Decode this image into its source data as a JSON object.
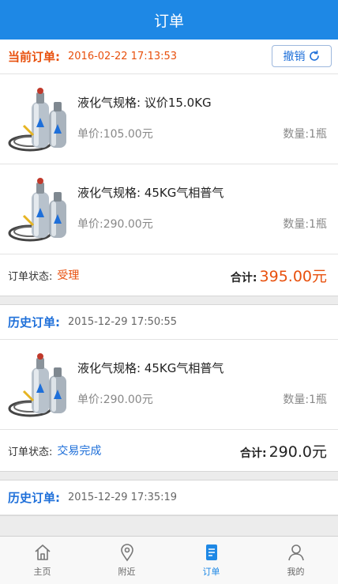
{
  "header": {
    "title": "订单"
  },
  "current": {
    "label": "当前订单:",
    "time": "2016-02-22 17:13:53",
    "cancel_label": "撤销",
    "items": [
      {
        "name": "液化气规格: 议价15.0KG",
        "price": "单价:105.00元",
        "qty": "数量:1瓶"
      },
      {
        "name": "液化气规格: 45KG气相普气",
        "price": "单价:290.00元",
        "qty": "数量:1瓶"
      }
    ],
    "status_label": "订单状态:",
    "status": "受理",
    "total_label": "合计:",
    "total": "395.00元"
  },
  "history1": {
    "label": "历史订单:",
    "time": "2015-12-29 17:50:55",
    "items": [
      {
        "name": "液化气规格: 45KG气相普气",
        "price": "单价:290.00元",
        "qty": "数量:1瓶"
      }
    ],
    "status_label": "订单状态:",
    "status": "交易完成",
    "total_label": "合计:",
    "total": "290.0元"
  },
  "history2": {
    "label": "历史订单:",
    "time": "2015-12-29 17:35:19"
  },
  "tabs": [
    {
      "label": "主页",
      "icon": "home-icon"
    },
    {
      "label": "附近",
      "icon": "location-pin-icon"
    },
    {
      "label": "订单",
      "icon": "order-list-icon"
    },
    {
      "label": "我的",
      "icon": "user-icon"
    }
  ],
  "colors": {
    "primary": "#1e88e5",
    "accent": "#e8500d",
    "link": "#1e6fd9"
  }
}
